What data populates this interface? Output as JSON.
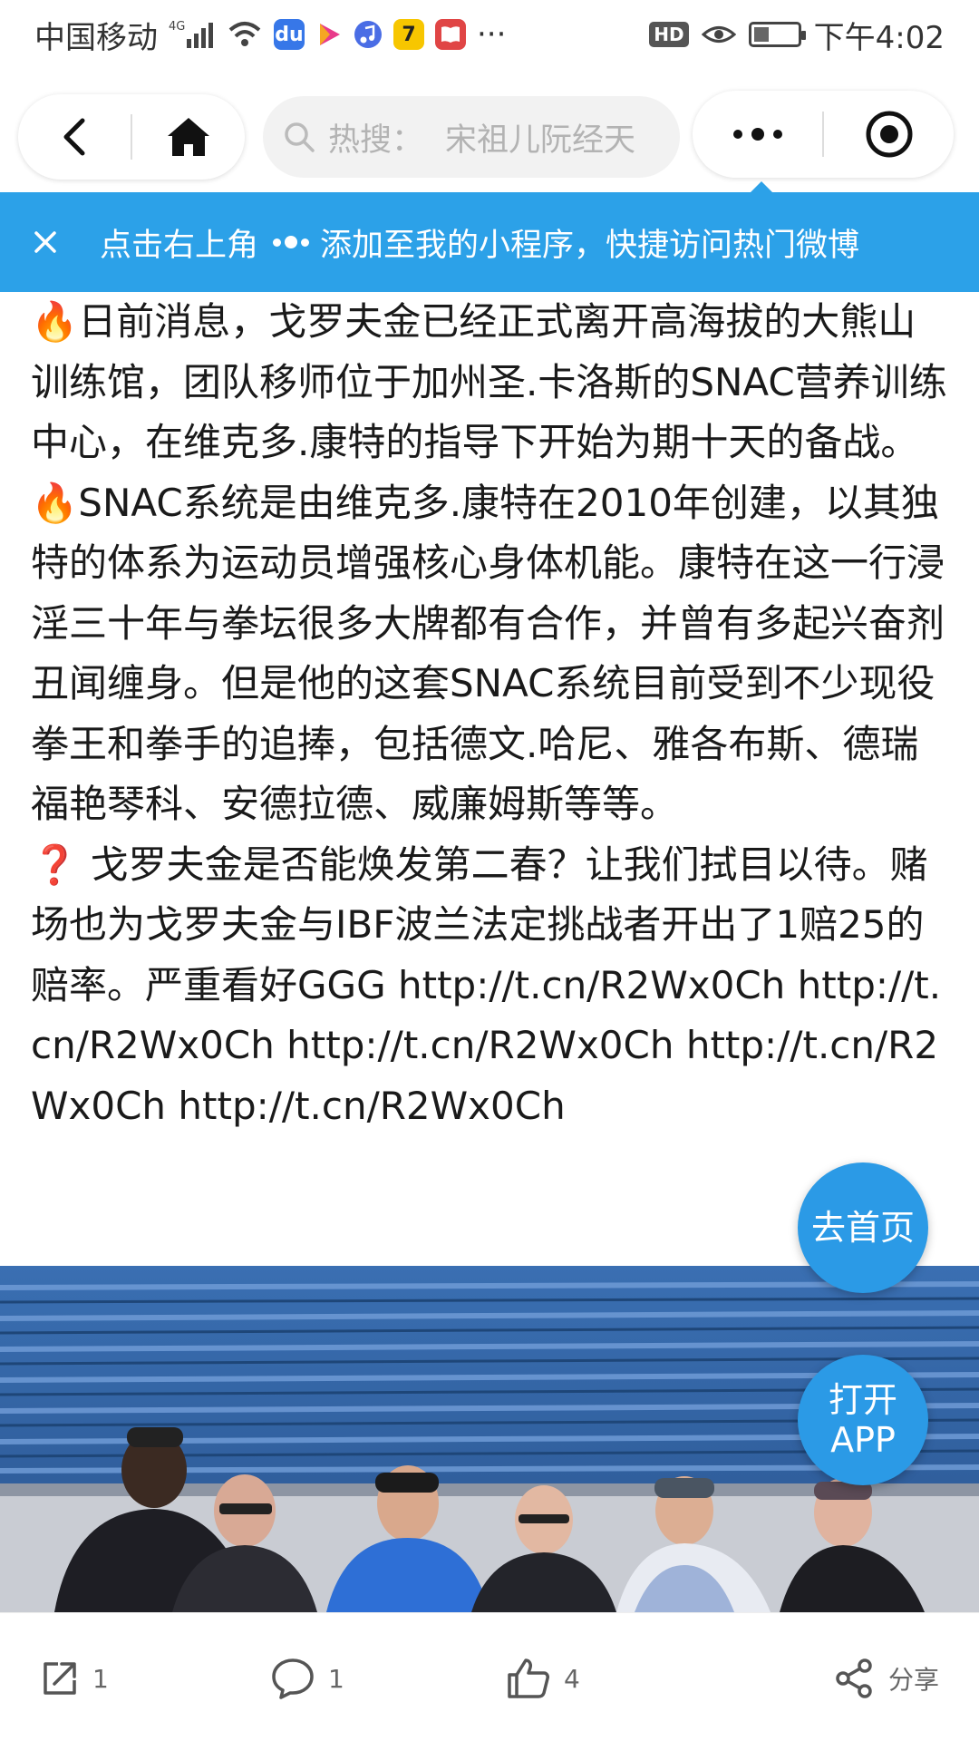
{
  "status_bar": {
    "carrier": "中国移动",
    "network": "4G",
    "overflow": "···",
    "hd": "HD",
    "time": "下午4:02",
    "battery_level": 0.35
  },
  "nav": {
    "back_icon": "chevron-left-icon",
    "home_icon": "home-icon",
    "search_prefix": "热搜：",
    "search_placeholder": "宋祖儿阮经天",
    "more_icon": "more-dots-icon",
    "close_icon": "target-circle-icon"
  },
  "banner": {
    "text_before": "点击右上角",
    "text_after": "添加至我的小程序，快捷访问热门微博"
  },
  "article": {
    "paragraphs": [
      {
        "emoji": "🔥",
        "text": "日前消息，戈罗夫金已经正式离开高海拔的大熊山训练馆，团队移师位于加州圣.卡洛斯的SNAC营养训练中心，在维克多.康特的指导下开始为期十天的备战。"
      },
      {
        "emoji": "🔥",
        "text": "SNAC系统是由维克多.康特在2010年创建，以其独特的体系为运动员增强核心身体机能。康特在这一行浸淫三十年与拳坛很多大牌都有合作，并曾有多起兴奋剂丑闻缠身。但是他的这套SNAC系统目前受到不少现役拳王和拳手的追捧，包括德文.哈尼、雅各布斯、德瑞福艳琴科、安德拉德、威廉姆斯等等。"
      },
      {
        "emoji": "❓",
        "text": "戈罗夫金是否能焕发第二春？让我们拭目以待。赌场也为戈罗夫金与IBF波兰法定挑战者开出了1赔25的赔率。严重看好GGG http://t.cn/R2Wx0Ch http://t.cn/R2Wx0Ch http://t.cn/R2Wx0Ch http://t.cn/R2Wx0Ch http://t.cn/R2Wx0Ch"
      }
    ]
  },
  "fab": {
    "home_label": "去首页",
    "app_line1": "打开",
    "app_line2": "APP"
  },
  "bottom_bar": {
    "repost_count": "1",
    "comment_count": "1",
    "like_count": "4",
    "share_label": "分享"
  },
  "colors": {
    "accent": "#2ca1e8",
    "fab": "#2b9ae6"
  }
}
